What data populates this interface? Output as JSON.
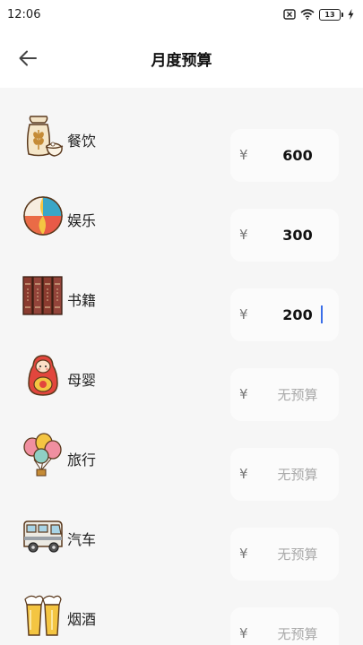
{
  "status": {
    "time": "12:06",
    "battery": "13"
  },
  "header": {
    "title": "月度预算"
  },
  "currency_symbol": "¥",
  "categories": [
    {
      "label": "餐饮",
      "value": "600",
      "placeholder": "无预算",
      "icon": "grain-sack-icon"
    },
    {
      "label": "娱乐",
      "value": "300",
      "placeholder": "无预算",
      "icon": "beach-ball-icon"
    },
    {
      "label": "书籍",
      "value": "200",
      "placeholder": "无预算",
      "icon": "books-icon"
    },
    {
      "label": "母婴",
      "value": "",
      "placeholder": "无预算",
      "icon": "nesting-doll-icon"
    },
    {
      "label": "旅行",
      "value": "",
      "placeholder": "无预算",
      "icon": "balloons-icon"
    },
    {
      "label": "汽车",
      "value": "",
      "placeholder": "无预算",
      "icon": "rv-camper-icon"
    },
    {
      "label": "烟酒",
      "value": "",
      "placeholder": "无预算",
      "icon": "beer-cheers-icon"
    }
  ],
  "colors": {
    "background": "#f6f6f6",
    "input_bg": "#fbfbfb",
    "text": "#222222",
    "placeholder": "#aaaaaa"
  }
}
